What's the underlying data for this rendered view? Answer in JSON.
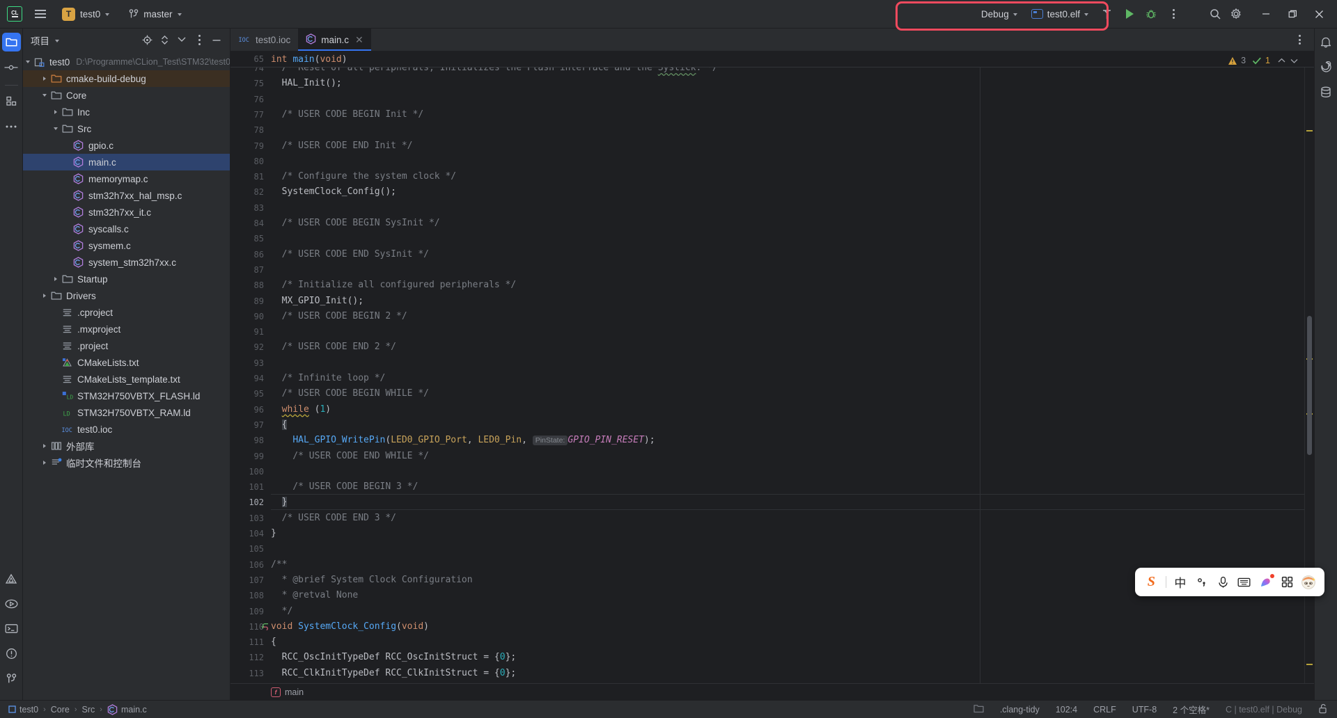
{
  "window": {
    "app": "CLion",
    "logo_text": "CL"
  },
  "toolbar": {
    "menu_icon": "hamburger-menu-icon",
    "project_badge": "T",
    "project_name": "test0",
    "vcs_icon": "git-branch-icon",
    "branch_name": "master",
    "run_config": "Debug",
    "target_icon": "elf-target-icon",
    "target_name": "test0.elf",
    "build_icon": "hammer-build-icon",
    "run_icon": "run-play-icon",
    "debug_icon": "debug-bug-icon",
    "more_icon": "more-vertical-icon",
    "search_icon": "search-icon",
    "settings_icon": "gear-settings-icon",
    "minimize_icon": "window-minimize-icon",
    "maximize_icon": "window-maximize-icon",
    "close_icon": "window-close-icon",
    "highlight_color": "#f24a5e"
  },
  "left_rail": {
    "items": [
      {
        "name": "project-tool-icon",
        "active": true
      },
      {
        "name": "commit-tool-icon",
        "active": false
      },
      {
        "name": "structure-tool-icon",
        "active": false
      },
      {
        "name": "more-tools-icon",
        "active": false
      }
    ],
    "bottom_items": [
      {
        "name": "cmake-tool-icon"
      },
      {
        "name": "run-tool-icon"
      },
      {
        "name": "terminal-tool-icon"
      },
      {
        "name": "problems-tool-icon"
      },
      {
        "name": "git-tool-icon"
      }
    ]
  },
  "project_panel": {
    "title": "项目",
    "actions": [
      {
        "name": "select-opened-file-icon"
      },
      {
        "name": "expand-collapse-icon"
      },
      {
        "name": "collapse-all-icon"
      },
      {
        "name": "options-menu-icon"
      },
      {
        "name": "hide-panel-icon"
      }
    ],
    "tree": [
      {
        "label": "test0",
        "suffix": "D:\\Programme\\CLion_Test\\STM32\\test0",
        "indent": 0,
        "arrow": "down",
        "icon": "module-icon",
        "state": "normal"
      },
      {
        "label": "cmake-build-debug",
        "suffix": "",
        "indent": 1,
        "arrow": "right",
        "icon": "folder-excluded-icon",
        "state": "highlight"
      },
      {
        "label": "Core",
        "suffix": "",
        "indent": 1,
        "arrow": "down",
        "icon": "folder-icon",
        "state": "normal"
      },
      {
        "label": "Inc",
        "suffix": "",
        "indent": 2,
        "arrow": "right",
        "icon": "folder-icon",
        "state": "normal"
      },
      {
        "label": "Src",
        "suffix": "",
        "indent": 2,
        "arrow": "down",
        "icon": "folder-icon",
        "state": "normal"
      },
      {
        "label": "gpio.c",
        "suffix": "",
        "indent": 3,
        "arrow": "none",
        "icon": "c-file-icon",
        "state": "normal"
      },
      {
        "label": "main.c",
        "suffix": "",
        "indent": 3,
        "arrow": "none",
        "icon": "c-file-icon",
        "state": "selected"
      },
      {
        "label": "memorymap.c",
        "suffix": "",
        "indent": 3,
        "arrow": "none",
        "icon": "c-file-icon",
        "state": "normal"
      },
      {
        "label": "stm32h7xx_hal_msp.c",
        "suffix": "",
        "indent": 3,
        "arrow": "none",
        "icon": "c-file-icon",
        "state": "normal"
      },
      {
        "label": "stm32h7xx_it.c",
        "suffix": "",
        "indent": 3,
        "arrow": "none",
        "icon": "c-file-icon",
        "state": "normal"
      },
      {
        "label": "syscalls.c",
        "suffix": "",
        "indent": 3,
        "arrow": "none",
        "icon": "c-file-icon",
        "state": "normal"
      },
      {
        "label": "sysmem.c",
        "suffix": "",
        "indent": 3,
        "arrow": "none",
        "icon": "c-file-icon",
        "state": "normal"
      },
      {
        "label": "system_stm32h7xx.c",
        "suffix": "",
        "indent": 3,
        "arrow": "none",
        "icon": "c-file-icon",
        "state": "normal"
      },
      {
        "label": "Startup",
        "suffix": "",
        "indent": 2,
        "arrow": "right",
        "icon": "folder-icon",
        "state": "normal"
      },
      {
        "label": "Drivers",
        "suffix": "",
        "indent": 1,
        "arrow": "right",
        "icon": "folder-icon",
        "state": "normal"
      },
      {
        "label": ".cproject",
        "suffix": "",
        "indent": 2,
        "arrow": "none",
        "icon": "xml-file-icon",
        "state": "normal"
      },
      {
        "label": ".mxproject",
        "suffix": "",
        "indent": 2,
        "arrow": "none",
        "icon": "text-file-icon",
        "state": "normal"
      },
      {
        "label": ".project",
        "suffix": "",
        "indent": 2,
        "arrow": "none",
        "icon": "xml-file-icon",
        "state": "normal"
      },
      {
        "label": "CMakeLists.txt",
        "suffix": "",
        "indent": 2,
        "arrow": "none",
        "icon": "cmake-file-icon",
        "state": "normal"
      },
      {
        "label": "CMakeLists_template.txt",
        "suffix": "",
        "indent": 2,
        "arrow": "none",
        "icon": "text-file-icon",
        "state": "normal"
      },
      {
        "label": "STM32H750VBTX_FLASH.ld",
        "suffix": "",
        "indent": 2,
        "arrow": "none",
        "icon": "linker-script-icon",
        "state": "normal"
      },
      {
        "label": "STM32H750VBTX_RAM.ld",
        "suffix": "",
        "indent": 2,
        "arrow": "none",
        "icon": "ld-file-icon",
        "state": "normal"
      },
      {
        "label": "test0.ioc",
        "suffix": "",
        "indent": 2,
        "arrow": "none",
        "icon": "ioc-file-icon",
        "state": "normal"
      },
      {
        "label": "外部库",
        "suffix": "",
        "indent": 1,
        "arrow": "right",
        "icon": "external-libraries-icon",
        "state": "normal"
      },
      {
        "label": "临时文件和控制台",
        "suffix": "",
        "indent": 1,
        "arrow": "right",
        "icon": "scratches-icon",
        "state": "normal"
      }
    ]
  },
  "editor": {
    "tabs": [
      {
        "label": "test0.ioc",
        "icon": "ioc-file-icon",
        "active": false,
        "closable": false
      },
      {
        "label": "main.c",
        "icon": "c-file-icon",
        "active": true,
        "closable": true
      }
    ],
    "sticky_line_number": "65",
    "sticky_code": "int main(void)",
    "inspections": {
      "warning_count": "3",
      "ok_count": "1",
      "warn_icon": "warning-triangle-icon",
      "ok_icon": "inspection-ok-icon"
    },
    "breadcrumb_function": "main",
    "first_line": 74,
    "lines": [
      {
        "n": 74,
        "t": "comment_clipped",
        "text": "  /* Reset of all peripherals, Initializes the Flash interface and the Systick. */"
      },
      {
        "n": 75,
        "t": "plain",
        "text": "  HAL_Init();"
      },
      {
        "n": 76,
        "t": "blank",
        "text": ""
      },
      {
        "n": 77,
        "t": "comment",
        "text": "  /* USER CODE BEGIN Init */"
      },
      {
        "n": 78,
        "t": "blank",
        "text": ""
      },
      {
        "n": 79,
        "t": "comment",
        "text": "  /* USER CODE END Init */"
      },
      {
        "n": 80,
        "t": "blank",
        "text": ""
      },
      {
        "n": 81,
        "t": "comment",
        "text": "  /* Configure the system clock */"
      },
      {
        "n": 82,
        "t": "plain",
        "text": "  SystemClock_Config();"
      },
      {
        "n": 83,
        "t": "blank",
        "text": ""
      },
      {
        "n": 84,
        "t": "comment",
        "text": "  /* USER CODE BEGIN SysInit */"
      },
      {
        "n": 85,
        "t": "blank",
        "text": ""
      },
      {
        "n": 86,
        "t": "comment",
        "text": "  /* USER CODE END SysInit */"
      },
      {
        "n": 87,
        "t": "blank",
        "text": ""
      },
      {
        "n": 88,
        "t": "comment",
        "text": "  /* Initialize all configured peripherals */"
      },
      {
        "n": 89,
        "t": "plain",
        "text": "  MX_GPIO_Init();"
      },
      {
        "n": 90,
        "t": "comment",
        "text": "  /* USER CODE BEGIN 2 */"
      },
      {
        "n": 91,
        "t": "blank",
        "text": ""
      },
      {
        "n": 92,
        "t": "comment",
        "text": "  /* USER CODE END 2 */"
      },
      {
        "n": 93,
        "t": "blank",
        "text": ""
      },
      {
        "n": 94,
        "t": "comment",
        "text": "  /* Infinite loop */"
      },
      {
        "n": 95,
        "t": "comment",
        "text": "  /* USER CODE BEGIN WHILE */"
      },
      {
        "n": 96,
        "t": "while",
        "text": "  while (1)"
      },
      {
        "n": 97,
        "t": "brace",
        "text": "  {"
      },
      {
        "n": 98,
        "t": "gpiocall",
        "text": "    HAL_GPIO_WritePin(LED0_GPIO_Port, LED0_Pin, PinState: GPIO_PIN_RESET);"
      },
      {
        "n": 99,
        "t": "comment",
        "text": "    /* USER CODE END WHILE */"
      },
      {
        "n": 100,
        "t": "blank",
        "text": ""
      },
      {
        "n": 101,
        "t": "comment",
        "text": "    /* USER CODE BEGIN 3 */"
      },
      {
        "n": 102,
        "t": "closebrace",
        "text": "  }"
      },
      {
        "n": 103,
        "t": "comment",
        "text": "  /* USER CODE END 3 */"
      },
      {
        "n": 104,
        "t": "plain",
        "text": "}"
      },
      {
        "n": 105,
        "t": "blank",
        "text": ""
      },
      {
        "n": 106,
        "t": "comment",
        "text": "/**"
      },
      {
        "n": 107,
        "t": "comment",
        "text": "  * @brief System Clock Configuration"
      },
      {
        "n": 108,
        "t": "comment",
        "text": "  * @retval None"
      },
      {
        "n": 109,
        "t": "comment",
        "text": "  */"
      },
      {
        "n": 110,
        "t": "funcdef",
        "text": "void SystemClock_Config(void)"
      },
      {
        "n": 111,
        "t": "plain",
        "text": "{"
      },
      {
        "n": 112,
        "t": "decl",
        "text": "  RCC_OscInitTypeDef RCC_OscInitStruct = {0};"
      },
      {
        "n": 113,
        "t": "decl",
        "text": "  RCC_ClkInitTypeDef RCC_ClkInitStruct = {0};"
      }
    ],
    "code_tokens": {
      "line98_fn": "HAL_GPIO_WritePin",
      "line98_arg1": "LED0_GPIO_Port",
      "line98_arg2": "LED0_Pin",
      "line98_hint": "PinState:",
      "line98_arg3": "GPIO_PIN_RESET",
      "line110_kw": "void",
      "line110_fn": "SystemClock_Config",
      "line110_params": "(void)",
      "line112_type": "RCC_OscInitTypeDef",
      "line112_var": "RCC_OscInitStruct",
      "line113_type": "RCC_ClkInitTypeDef",
      "line113_var": "RCC_ClkInitStruct",
      "line96_kw": "while",
      "line96_cond": "(1)"
    }
  },
  "right_rail": {
    "items": [
      {
        "name": "notifications-icon"
      },
      {
        "name": "ai-assistant-icon"
      },
      {
        "name": "database-icon"
      }
    ]
  },
  "status_bar": {
    "breadcrumb": [
      "test0",
      "Core",
      "Src",
      "main.c"
    ],
    "breadcrumb_file_icon": "c-file-icon",
    "folder_icon": "folder-icon",
    "clang_tidy": ".clang-tidy",
    "caret_position": "102:4",
    "line_separator": "CRLF",
    "encoding": "UTF-8",
    "indent": "2 个空格*",
    "config_summary": "C | test0.elf | Debug",
    "lock_icon": "unlocked-icon"
  },
  "ime_bar": {
    "logo": "S",
    "items": [
      {
        "name": "ime-logo-icon",
        "glyph": "S"
      },
      {
        "name": "ime-chinese-mode-icon",
        "glyph": "中"
      },
      {
        "name": "ime-punctuation-icon",
        "glyph": "°,"
      },
      {
        "name": "ime-voice-input-icon",
        "glyph": "mic"
      },
      {
        "name": "ime-soft-keyboard-icon",
        "glyph": "kbd"
      },
      {
        "name": "ime-toolbox-icon",
        "glyph": "shape"
      },
      {
        "name": "ime-apps-grid-icon",
        "glyph": "grid"
      },
      {
        "name": "ime-avatar-icon",
        "glyph": "face"
      }
    ]
  }
}
